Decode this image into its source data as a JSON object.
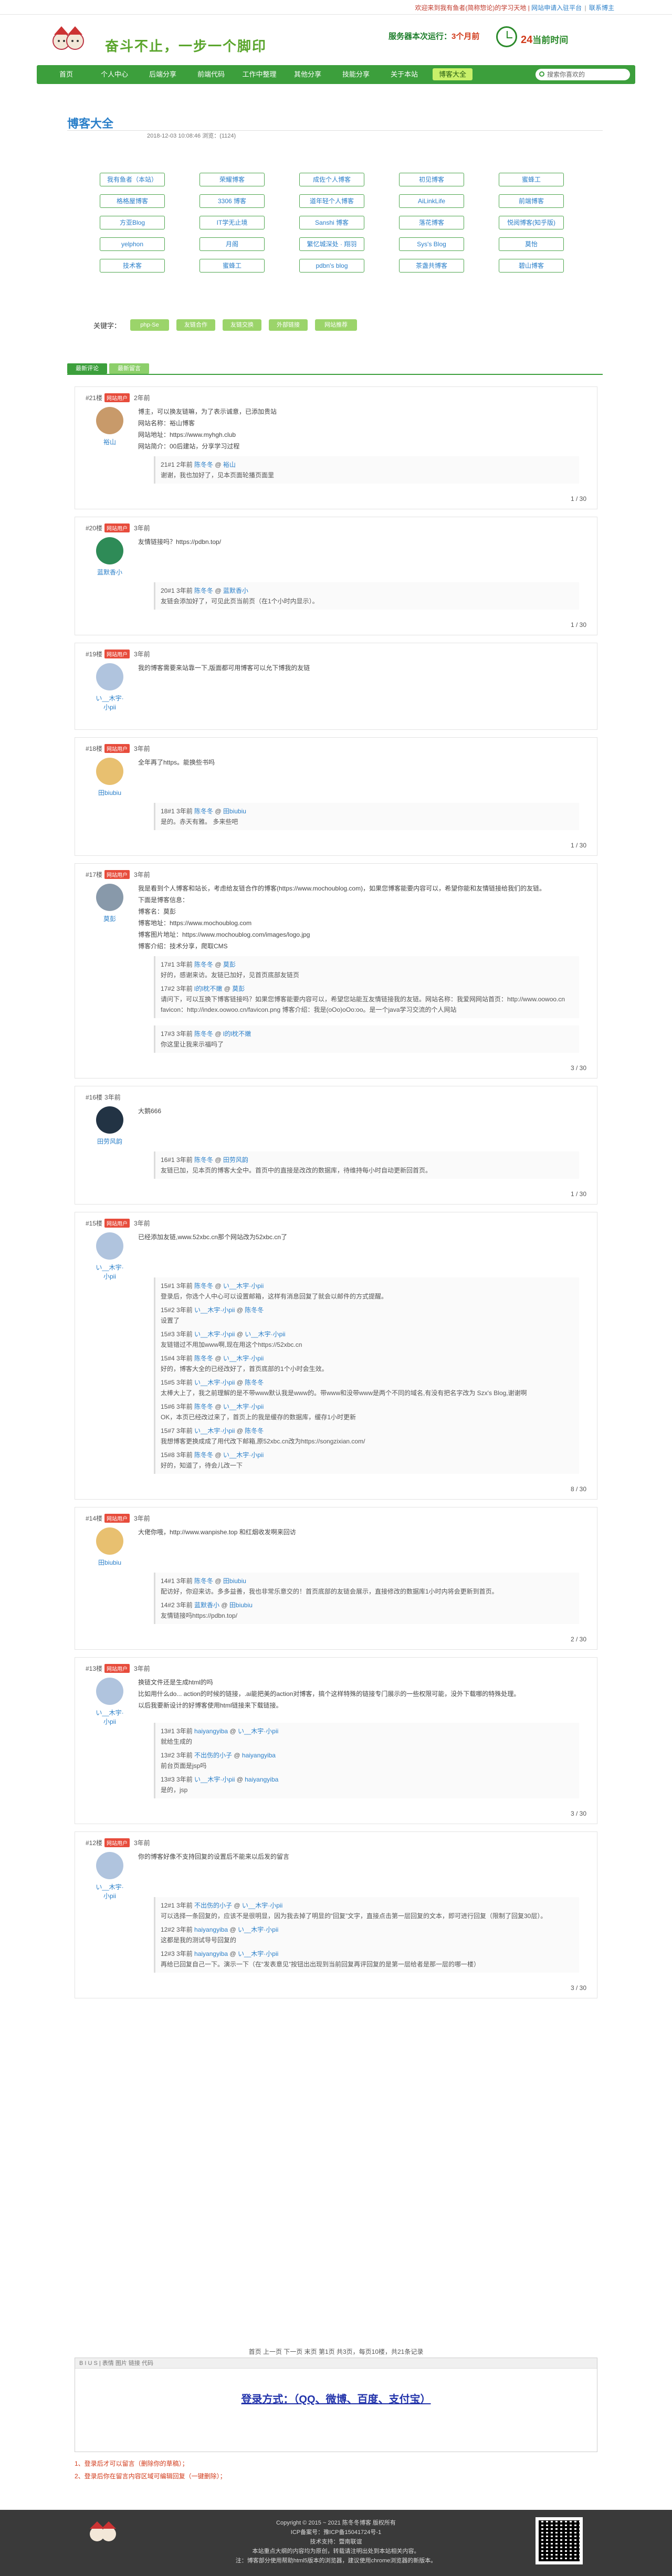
{
  "notice": {
    "prefix": "欢迎来到我有鱼者(简称惣论)的学习天地 | ",
    "link1": "网站申请入驻平台",
    "sep": " | ",
    "link2": "联系博主"
  },
  "header": {
    "slogan": "奋斗不止，一步一个脚印",
    "runtime_label": "服务器本次运行：",
    "runtime_value": "3个月前",
    "hot": "24",
    "hot_label": "当前时间"
  },
  "nav": {
    "items": [
      "首页",
      "个人中心",
      "后端分享",
      "前端代码",
      "工作中整理",
      "其他分享",
      "技能分享",
      "关于本站",
      "博客大全"
    ],
    "search_placeholder": "搜索你喜欢的"
  },
  "page": {
    "title": "博客大全",
    "meta": "2018-12-03 10:08:46 浏览：(1124)"
  },
  "links": [
    "我有鱼者（本站）",
    "荣耀博客",
    "成佐个人博客",
    "初见博客",
    "蜜蜂工",
    "格格屋博客",
    "3306 博客",
    "道年轻个人博客",
    "AiLinkLife",
    "前端博客",
    "方亚Blog",
    "IT学无止境",
    "Sanshi 博客",
    "落花博客",
    "悦阅博客(知乎版)",
    "yelphon",
    "月阁",
    "繁忆城深处 · 翔羽",
    "Sys's Blog",
    "莫怡",
    "技术客",
    "蜜蜂工",
    "pdbn's blog",
    "茶盏共博客",
    "碧山博客"
  ],
  "keywords": {
    "label": "关键字：",
    "tags": [
      "php-Se",
      "友链合作",
      "友链交换",
      "外部链接",
      "网站推荐"
    ]
  },
  "tabs": [
    "最新评论",
    "最新留言"
  ],
  "comments": [
    {
      "floor": "#21楼",
      "badge": "网站用户",
      "time": "2年前",
      "user": "裕山",
      "body": [
        "博主，可以换友链嘛，为了表示诚意，已添加贵站",
        "网站名称：裕山博客",
        "网站地址：https://www.myhgh.club",
        "网站简介：00后建站，分享学习过程"
      ],
      "replies": [
        [
          "21#1 2年前 ",
          "陈冬冬 ",
          "@ ",
          "裕山",
          "",
          "谢谢，我也加好了，见本页面轮播页面里"
        ]
      ],
      "page": "1 / 30"
    },
    {
      "floor": "#20楼",
      "badge": "网站用户",
      "time": "3年前",
      "user": "蓝默香小",
      "body": [
        "友情链接吗？https://pdbn.top/"
      ],
      "replies": [
        [
          "20#1 3年前 ",
          "陈冬冬 ",
          "@ ",
          "蓝默香小",
          "",
          "友链会添加好了，可见此页当前页（在1个小时内显示）。"
        ]
      ],
      "page": "1 / 30"
    },
    {
      "floor": "#19楼",
      "badge": "网站用户",
      "time": "3年前",
      "user": "い__木宇·小pii",
      "body": [
        "我的博客需要来站靠一下,版面都可用博客可以允下博我的友链"
      ],
      "replies": [],
      "page": ""
    },
    {
      "floor": "#18楼",
      "badge": "网站用户",
      "time": "3年前",
      "user": "田biubiu",
      "body": [
        "全年再了https。能换些书吗"
      ],
      "replies": [
        [
          "18#1 3年前 ",
          "陈冬冬 ",
          "@ ",
          "田biubiu",
          "",
          "是的。赤天有雅。 多来些吧"
        ]
      ],
      "page": "1 / 30"
    },
    {
      "floor": "#17楼",
      "badge": "网站用户",
      "time": "3年前",
      "user": "莫彭",
      "body": [
        "我是看到个人博客和站长，考虑给友链合作的博客(https://www.mochoublog.com)，如果您博客能要内容可以，希望你能和友情链接给我们的友链。",
        "下面是博客信息：",
        "博客名：莫彭",
        "博客地址：https://www.mochoublog.com",
        "博客图片地址：https://www.mochoublog.com/images/logo.jpg",
        "博客介绍：技术分享，爬取CMS"
      ],
      "replies": [
        [
          "17#1 3年前 ",
          "陈冬冬 ",
          "@ ",
          "莫彭",
          "",
          "好的，感谢来访。友链已加好，见首页底部友链页"
        ],
        [
          "17#2 3年前 ",
          "l的l枕不嫩 ",
          "@ ",
          "莫彭",
          "",
          "请问下，可以互换下博客链接吗？如果您博客能要内容可以，希望您站能互友情链接我的友链。网站名称：我爱网网站首页：http://www.oowoo.cn favicon：http://index.oowoo.cn/favicon.png 博客介绍：我是(oOo)oOo:oo。是一个java学习交流的个人网站"
        ],
        [
          "17#3 3年前 ",
          "陈冬冬 ",
          "@ ",
          "l的l枕不嫩",
          "",
          "你这里让我来示福吗了"
        ]
      ],
      "page": "3 / 30"
    },
    {
      "floor": "#16楼",
      "badge": "",
      "time": "3年前",
      "user": "田劳风韵",
      "body": [
        "大鹅666"
      ],
      "replies": [
        [
          "16#1 3年前 ",
          "陈冬冬 ",
          "@ ",
          "田劳风韵",
          "",
          "友链已加，见本页的博客大全中。首页中的直接是改改的数据库，待维持每小时自动更新回首页。"
        ]
      ],
      "page": "1 / 30"
    },
    {
      "floor": "#15楼",
      "badge": "网站用户",
      "time": "3年前",
      "user": "い__木宇·小pii",
      "body": [
        "已经添加友链,www.52xbc.cn那个网站改为52xbc.cn了"
      ],
      "replies": [
        [
          "15#1 3年前 ",
          "陈冬冬 ",
          "@ ",
          "い__木宇·小pii",
          "",
          "登录后，你选个人中心可以设置邮箱，这样有消息回复了就会以邮件的方式提醒。"
        ],
        [
          "15#2 3年前 ",
          "い__木宇·小pii ",
          "@ ",
          "陈冬冬",
          "",
          "设置了"
        ],
        [
          "15#3 3年前 ",
          "い__木宇·小pii ",
          "@ ",
          "い__木宇·小pii",
          "",
          "友链错过不用加www啊,现在用这个https://52xbc.cn"
        ],
        [
          "15#4 3年前 ",
          "陈冬冬 ",
          "@ ",
          "い__木宇·小pii",
          "",
          "好的，博客大全的已经改好了，首页底部的1个小时会生效。"
        ],
        [
          "15#5 3年前 ",
          "い__木宇·小pii ",
          "@ ",
          "陈冬冬",
          "",
          "太棒大上了，我之前理解的是不带www默认我是www的。带www和没带www是两个不同的域名,有没有把名字改为 Szx's Blog,谢谢啊"
        ],
        [
          "15#6 3年前 ",
          "陈冬冬 ",
          "@ ",
          "い__木宇·小pii",
          "",
          "OK，本页已经改过来了，首页上的我是缓存的数据库，缓存1小时更新"
        ],
        [
          "15#7 3年前 ",
          "い__木宇·小pii ",
          "@ ",
          "陈冬冬",
          "",
          "我想博客更换成成了用代改下邮箱,原52xbc.cn改为https://songzixian.com/"
        ],
        [
          "15#8 3年前 ",
          "陈冬冬 ",
          "@ ",
          "い__木宇·小pii",
          "",
          "好的，知道了，待会儿改一下"
        ]
      ],
      "page": "8 / 30"
    },
    {
      "floor": "#14楼",
      "badge": "网站用户",
      "time": "3年前",
      "user": "田biubiu",
      "body": [
        "大佬你哦，http://www.wanpishe.top 和红烟收发啊来回访"
      ],
      "replies": [
        [
          "14#1 3年前 ",
          "陈冬冬 ",
          "@ ",
          "田biubiu",
          "",
          "配访好，你迎来访。多多益善，我也非常乐意交的！首页底部的友链会展示，直接修改的数据库1小时内将会更新到首页。"
        ],
        [
          "14#2 3年前 ",
          "蓝默香小 ",
          "@ ",
          "田biubiu",
          "",
          "友情链接吗https://pdbn.top/"
        ]
      ],
      "page": "2 / 30"
    },
    {
      "floor": "#13楼",
      "badge": "网站用户",
      "time": "3年前",
      "user": "い__木宇·小pii",
      "body": [
        "换链文件还是生成html的吗",
        "比如用什么do... action的时候的链接，.ai能把美的action对博客，搞个这样特殊的链接专门展示的一些权限可能，没外下载哪的特殊处理。",
        "以后我要新设计的好博客使用html链接来下载链接。"
      ],
      "replies": [
        [
          "13#1 3年前 ",
          "haiyangyiba ",
          "@ ",
          "い__木宇·小pii",
          "",
          "就给生成的"
        ],
        [
          "13#2 3年前 ",
          "不出伤的小子 ",
          "@ ",
          "haiyangyiba",
          "",
          "前台页面是jsp吗"
        ],
        [
          "13#3 3年前 ",
          "い__木宇·小pii ",
          "@ ",
          "haiyangyiba",
          "",
          "是的，jsp"
        ]
      ],
      "page": "3 / 30"
    },
    {
      "floor": "#12楼",
      "badge": "网站用户",
      "time": "3年前",
      "user": "い__木宇·小pii",
      "body": [
        "你的博客好像不支持回复的设置后不能来以后发的留言"
      ],
      "replies": [
        [
          "12#1 3年前 ",
          "不出伤的小子 ",
          "@ ",
          "い__木宇·小pii",
          "",
          "可以选择一条回复的，应该不是很明显，因为我去掉了明显的“回复”文字，直接点击第一层回复的文本，即可进行回复（限制了回复30层）。"
        ],
        [
          "12#2 3年前 ",
          "haiyangyiba ",
          "@ ",
          "い__木宇·小pii",
          "",
          "这都是我的测试导号回复的"
        ],
        [
          "12#3 3年前 ",
          "haiyangyiba ",
          "@ ",
          "い__木宇·小pii",
          "",
          "再给已回复自己一下。演示一下（在“发表意见”按钮出出现到当前回复再评回复的是第一层给者是那一层的哪一楼）"
        ]
      ],
      "page": "3 / 30"
    }
  ],
  "footer_pager": "首页 上一页 下一页 末页 第1页 共3页，每页10楼，共21条记录",
  "editor": {
    "toolbar": "B I U S | 表情 图片 链接 代码",
    "login_tip": "登录方式：（QQ、微博、百度、支付宝）"
  },
  "hints": [
    "1、登录后才可以留言（删除你的草稿）；",
    "2、登录后你在留言内容区域可编辑回复（一键删除）；"
  ],
  "footer": {
    "copy": "Copyright © 2015 ~ 2021 陈冬冬博客 版权所有",
    "icp": "ICP备案号：豫ICP备15041724号-1",
    "power": "技术支持：暨南联谊",
    "note1": "本站重点大纲的内容均为原创，转载请注明出处到本站相关内容。",
    "note2": "注：博客部分使用帮助html5版本的浏览器，建议使用chrome浏览器的新版本。"
  }
}
